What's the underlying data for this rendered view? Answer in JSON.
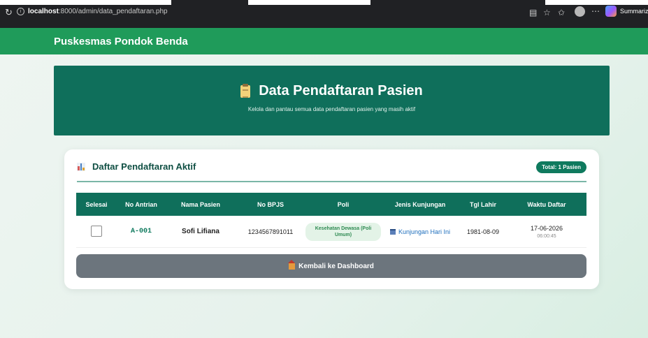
{
  "browser": {
    "reload_icon": "reload-icon",
    "url_host": "localhost",
    "url_path": ":8000/admin/data_pendaftaran.php",
    "extension_label": "Summariz"
  },
  "navbar": {
    "brand": "Puskesmas Pondok Benda"
  },
  "hero": {
    "title": "Data Pendaftaran Pasien",
    "subtitle": "Kelola dan pantau semua data pendaftaran pasien yang masih aktif",
    "icon": "clipboard-icon"
  },
  "card": {
    "title": "Daftar Pendaftaran Aktif",
    "total_badge": "Total: 1 Pasien",
    "icon": "bar-chart-icon"
  },
  "table": {
    "headers": [
      "Selesai",
      "No Antrian",
      "Nama Pasien",
      "No BPJS",
      "Poli",
      "Jenis Kunjungan",
      "Tgl Lahir",
      "Waktu Daftar"
    ],
    "rows": [
      {
        "no_antrian": "A-001",
        "nama": "Sofi Lifiana",
        "no_bpjs": "1234567891011",
        "poli": "Kesehatan Dewasa (Poli Umum)",
        "jenis": "Kunjungan Hari Ini",
        "tgl_lahir": "1981-08-09",
        "waktu_tanggal": "17-06-2026",
        "waktu_jam": "06:00:45"
      }
    ]
  },
  "actions": {
    "back_label": "Kembali ke Dashboard"
  },
  "colors": {
    "navbar": "#1f9b5a",
    "hero": "#0f6f5b",
    "table_header": "#0f6f5b",
    "badge": "#0f7a5e",
    "back_button": "#6c757d"
  }
}
